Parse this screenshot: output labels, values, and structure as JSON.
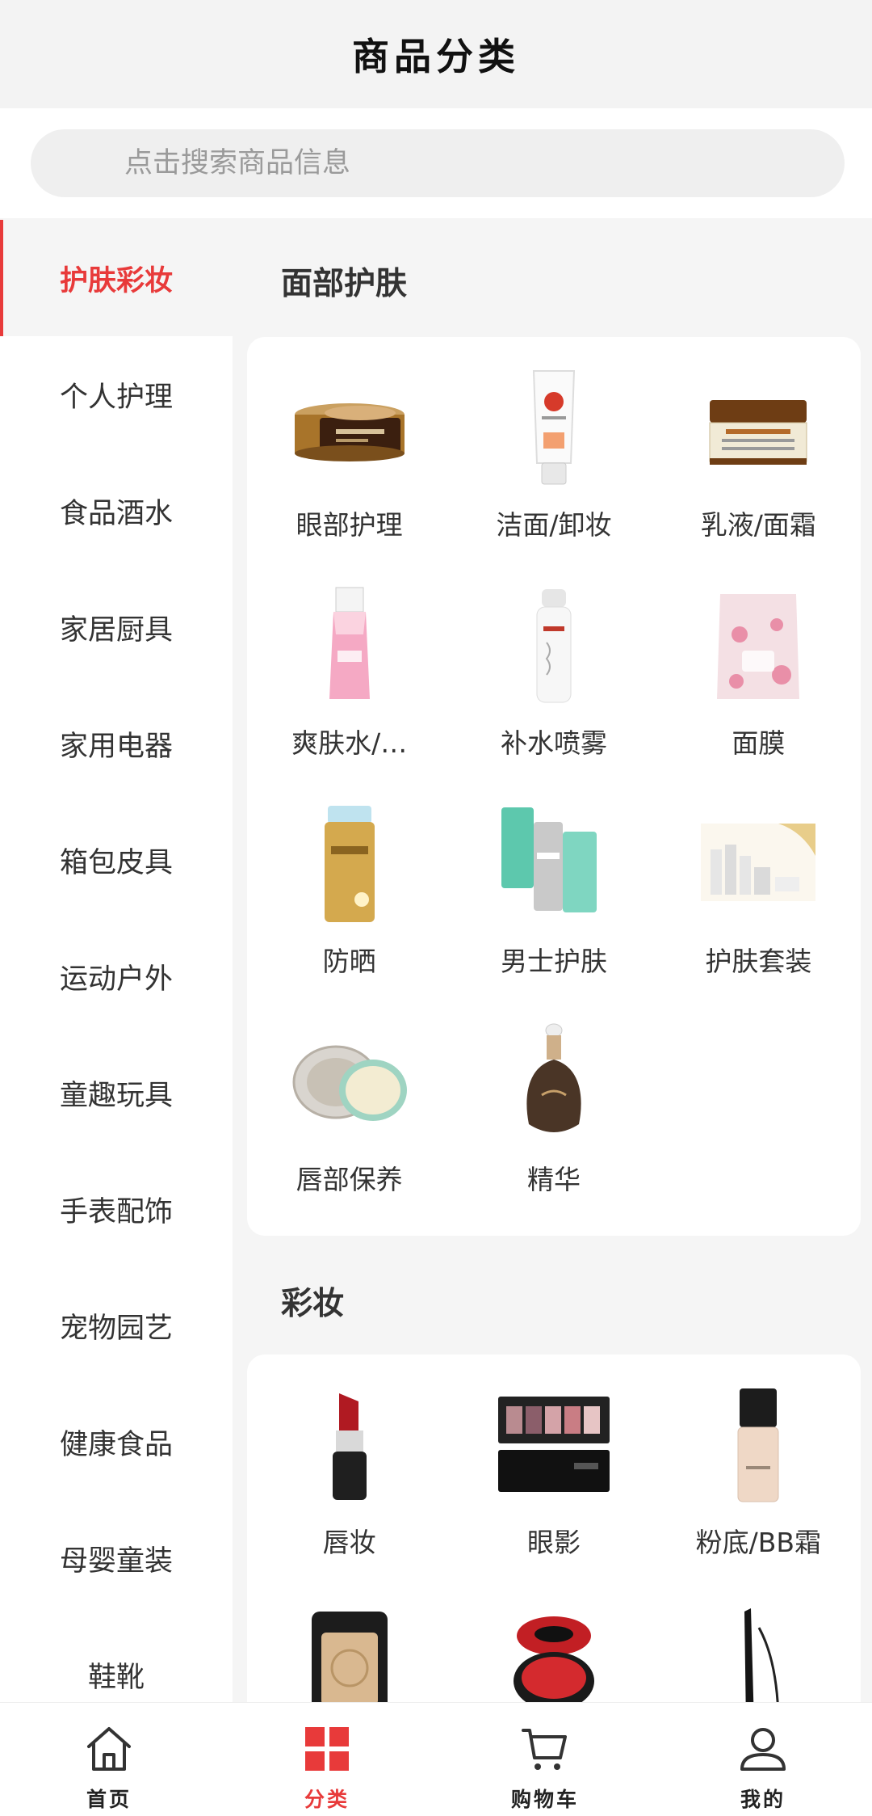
{
  "header": {
    "title": "商品分类"
  },
  "search": {
    "placeholder": "点击搜索商品信息"
  },
  "sidebar": {
    "items": [
      {
        "label": "护肤彩妆",
        "active": true
      },
      {
        "label": "个人护理"
      },
      {
        "label": "食品酒水"
      },
      {
        "label": "家居厨具"
      },
      {
        "label": "家用电器"
      },
      {
        "label": "箱包皮具"
      },
      {
        "label": "运动户外"
      },
      {
        "label": "童趣玩具"
      },
      {
        "label": "手表配饰"
      },
      {
        "label": "宠物园艺"
      },
      {
        "label": "健康食品"
      },
      {
        "label": "母婴童装"
      },
      {
        "label": "鞋靴"
      }
    ]
  },
  "sections": [
    {
      "title": "面部护肤",
      "items": [
        {
          "label": "眼部护理",
          "icon": "eye-cream-jar-icon"
        },
        {
          "label": "洁面/卸妆",
          "icon": "cleanser-tube-icon"
        },
        {
          "label": "乳液/面霜",
          "icon": "cream-jar-icon"
        },
        {
          "label": "爽肤水/…",
          "icon": "toner-bottle-icon"
        },
        {
          "label": "补水喷雾",
          "icon": "spray-bottle-icon"
        },
        {
          "label": "面膜",
          "icon": "mask-pouch-icon"
        },
        {
          "label": "防晒",
          "icon": "sunscreen-bottle-icon"
        },
        {
          "label": "男士护肤",
          "icon": "mens-skincare-icon"
        },
        {
          "label": "护肤套装",
          "icon": "skincare-set-icon"
        },
        {
          "label": "唇部保养",
          "icon": "lip-balm-jar-icon"
        },
        {
          "label": "精华",
          "icon": "serum-bottle-icon"
        }
      ]
    },
    {
      "title": "彩妆",
      "items": [
        {
          "label": "唇妆",
          "icon": "lipstick-icon"
        },
        {
          "label": "眼影",
          "icon": "eyeshadow-palette-icon"
        },
        {
          "label": "粉底/BB霜",
          "icon": "foundation-bottle-icon"
        },
        {
          "label": "",
          "icon": "powder-compact-icon"
        },
        {
          "label": "",
          "icon": "cushion-compact-icon"
        },
        {
          "label": "",
          "icon": "eyeliner-pen-icon"
        }
      ]
    }
  ],
  "bottom_nav": {
    "items": [
      {
        "label": "首页",
        "icon": "home-icon"
      },
      {
        "label": "分类",
        "icon": "category-grid-icon",
        "active": true
      },
      {
        "label": "购物车",
        "icon": "cart-icon"
      },
      {
        "label": "我的",
        "icon": "user-icon"
      }
    ]
  },
  "colors": {
    "accent": "#e83a3a",
    "page_bg": "#f5f5f5"
  }
}
